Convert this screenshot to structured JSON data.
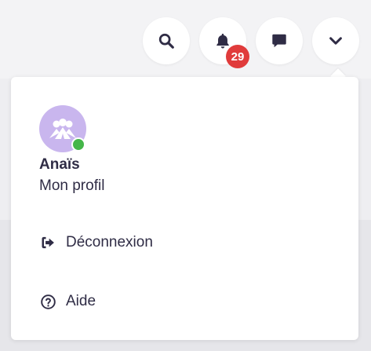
{
  "header": {
    "search_icon": "search-icon",
    "notifications": {
      "icon": "bell-icon",
      "count": "29"
    },
    "messages_icon": "chat-icon",
    "menu_icon": "chevron-down-icon"
  },
  "user_menu": {
    "user": {
      "name": "Anaïs",
      "profile_label": "Mon profil",
      "status": "online",
      "status_color": "#45b649",
      "avatar_color": "#c9b6ee"
    },
    "items": [
      {
        "label": "Déconnexion",
        "icon": "sign-out-icon"
      },
      {
        "label": "Aide",
        "icon": "help-circle-icon"
      }
    ]
  },
  "colors": {
    "text": "#2f2c45",
    "badge": "#e03b3b",
    "background": "#f1f1f3"
  }
}
